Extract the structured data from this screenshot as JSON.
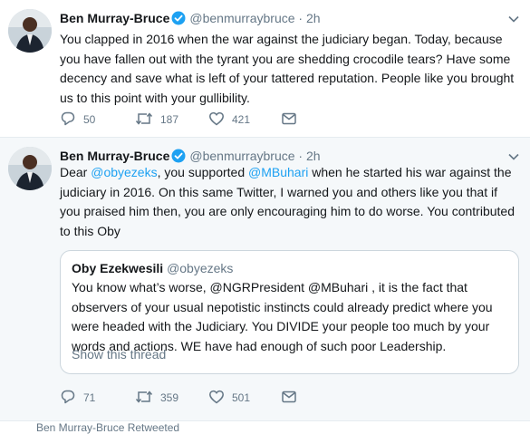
{
  "tweets": [
    {
      "author": {
        "name": "Ben Murray-Bruce",
        "handle": "@benmurraybruce",
        "separator": "·",
        "time": "2h",
        "verified": true
      },
      "text": "You clapped in 2016 when the war against the judiciary began. Today, because you have fallen out with the tyrant you are shedding crocodile tears? Have some decency and save what is left of your tattered reputation. People like you brought us to this point with your gullibility.",
      "actions": {
        "replies": "50",
        "retweets": "187",
        "likes": "421"
      }
    },
    {
      "author": {
        "name": "Ben Murray-Bruce",
        "handle": "@benmurraybruce",
        "separator": "·",
        "time": "2h",
        "verified": true
      },
      "text_parts": {
        "p1": "Dear ",
        "m1": "@obyezeks",
        "p2": ", you supported ",
        "m2": "@MBuhari",
        "p3": " when he started his war against the judiciary in 2016. On this same Twitter, I warned you and others like you that if you praised him then, you are only encouraging him to do worse. You contributed to this Oby"
      },
      "quoted": {
        "name": "Oby Ezekwesili",
        "handle": "@obyezeks",
        "text": "You know what’s worse, @NGRPresident @MBuhari , it is the fact that observers of your usual  nepotistic instincts could already predict where you were headed with the Judiciary. You DIVIDE your people too much by your words and actions. WE have had enough of such poor Leadership.",
        "show_thread": "Show this thread"
      },
      "actions": {
        "replies": "71",
        "retweets": "359",
        "likes": "501"
      }
    }
  ],
  "next_retweet_context": "Ben Murray-Bruce Retweeted",
  "colors": {
    "accent": "#1da1f2",
    "muted": "#657786",
    "text": "#14171a",
    "border": "#e6ecf0"
  },
  "icons": [
    "verified-badge-icon",
    "chevron-down-icon",
    "reply-icon",
    "retweet-icon",
    "like-icon",
    "message-icon"
  ]
}
